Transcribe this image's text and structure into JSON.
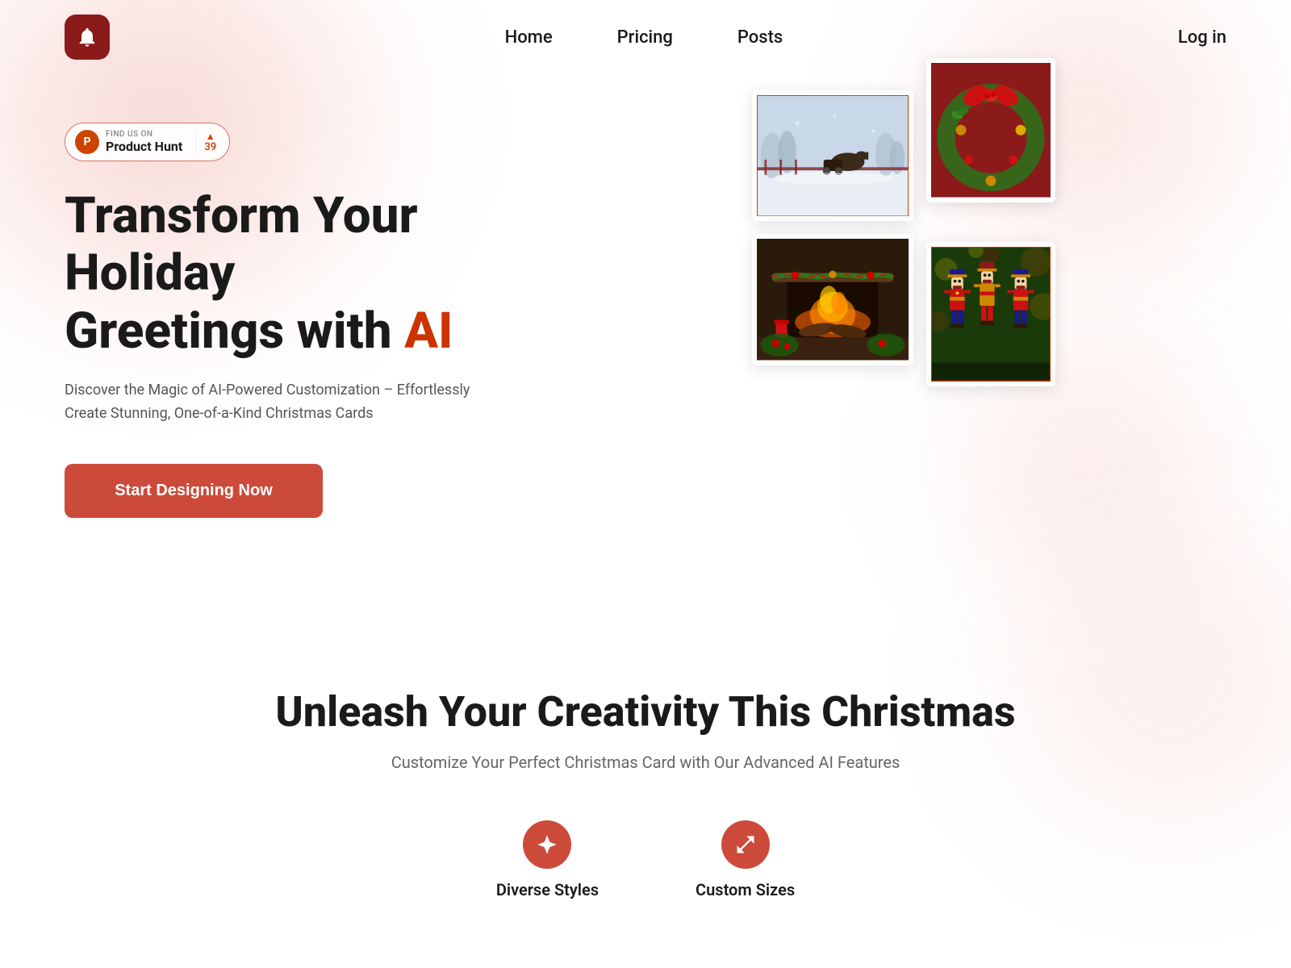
{
  "nav": {
    "logo_alt": "Christmas Card App Logo",
    "links": [
      {
        "label": "Home",
        "href": "#"
      },
      {
        "label": "Pricing",
        "href": "#"
      },
      {
        "label": "Posts",
        "href": "#"
      }
    ],
    "login_label": "Log in"
  },
  "product_hunt": {
    "find_label": "FIND Us ON",
    "name": "Product Hunt",
    "count": "39"
  },
  "hero": {
    "title_part1": "Transform Your Holiday",
    "title_part2": "Greetings with ",
    "title_highlight": "AI",
    "subtitle": "Discover the Magic of AI-Powered Customization – Effortlessly Create Stunning, One-of-a-Kind Christmas Cards",
    "cta_label": "Start Designing Now"
  },
  "section2": {
    "heading": "Unleash Your Creativity This Christmas",
    "subheading": "Customize Your Perfect Christmas Card with Our Advanced AI Features",
    "features": [
      {
        "label": "Diverse Styles",
        "icon": "sparkle"
      },
      {
        "label": "Custom Sizes",
        "icon": "resize"
      }
    ]
  },
  "images": [
    {
      "alt": "Winter horse carriage scene",
      "color_top": "#a8c4d4",
      "color_bottom": "#d0e4ee"
    },
    {
      "alt": "Christmas wreath decoration",
      "color_top": "#8B1A1A",
      "color_bottom": "#c0392b"
    },
    {
      "alt": "Christmas fireplace scene",
      "color_top": "#4a2010",
      "color_bottom": "#8B3A1A"
    },
    {
      "alt": "Nutcracker soldiers",
      "color_top": "#2d5a1a",
      "color_bottom": "#5a8a2a"
    }
  ],
  "colors": {
    "primary": "#cc4a3a",
    "dark_red": "#8B1A1A",
    "text_dark": "#1a1a1a",
    "text_muted": "#555555"
  }
}
